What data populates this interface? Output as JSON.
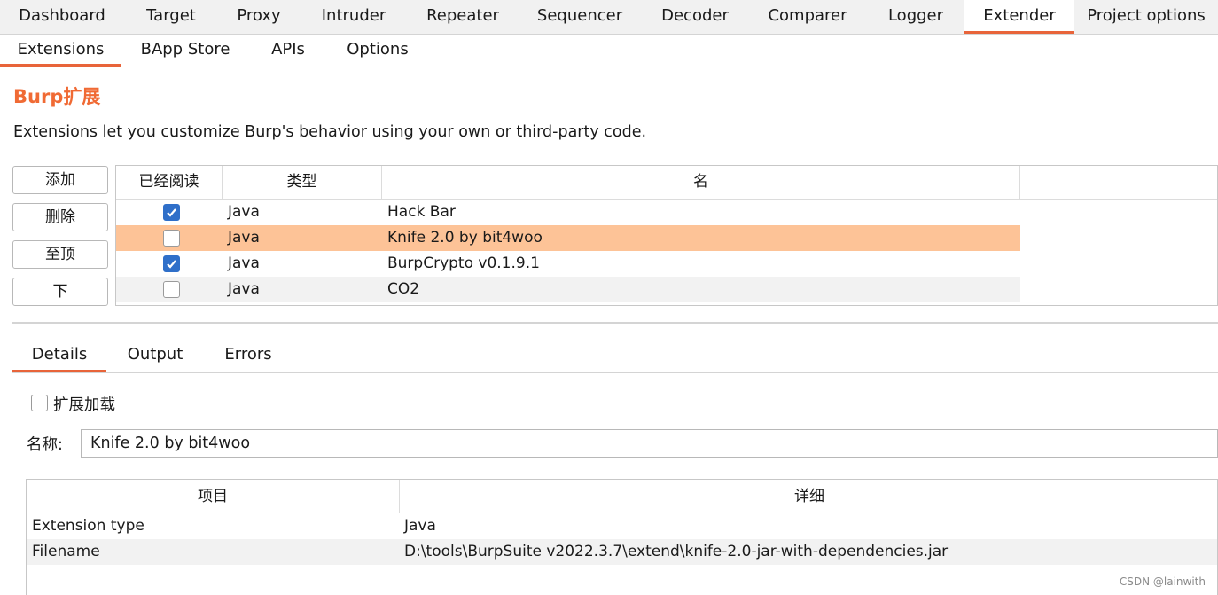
{
  "top_tabs": [
    "Dashboard",
    "Target",
    "Proxy",
    "Intruder",
    "Repeater",
    "Sequencer",
    "Decoder",
    "Comparer",
    "Logger",
    "Extender",
    "Project options"
  ],
  "sub_tabs": [
    "Extensions",
    "BApp Store",
    "APIs",
    "Options"
  ],
  "section": {
    "title": "Burp扩展",
    "description": "Extensions let you customize Burp's behavior using your own or third-party code."
  },
  "buttons": {
    "add": "添加",
    "remove": "删除",
    "top": "至顶",
    "down": "下"
  },
  "ext_table": {
    "headers": [
      "已经阅读",
      "类型",
      "名"
    ],
    "rows": [
      {
        "loaded": true,
        "type": "Java",
        "name": "Hack Bar"
      },
      {
        "loaded": false,
        "type": "Java",
        "name": "Knife 2.0 by bit4woo"
      },
      {
        "loaded": true,
        "type": "Java",
        "name": "BurpCrypto v0.1.9.1"
      },
      {
        "loaded": false,
        "type": "Java",
        "name": "CO2"
      }
    ]
  },
  "detail_tabs": [
    "Details",
    "Output",
    "Errors"
  ],
  "details": {
    "load_checkbox_label": "扩展加载",
    "load_checked": false,
    "name_label": "名称:",
    "name_value": "Knife 2.0 by bit4woo"
  },
  "info_table": {
    "headers": [
      "项目",
      "详细"
    ],
    "rows": [
      {
        "item": "Extension type",
        "detail": "Java"
      },
      {
        "item": "Filename",
        "detail": "D:\\tools\\BurpSuite v2022.3.7\\extend\\knife-2.0-jar-with-dependencies.jar"
      }
    ]
  },
  "watermark": "CSDN @lainwith",
  "colors": {
    "accent": "#e8643a",
    "title": "#f06a34",
    "selected_row": "#fdc397",
    "checkbox_on": "#2f6fc9"
  }
}
